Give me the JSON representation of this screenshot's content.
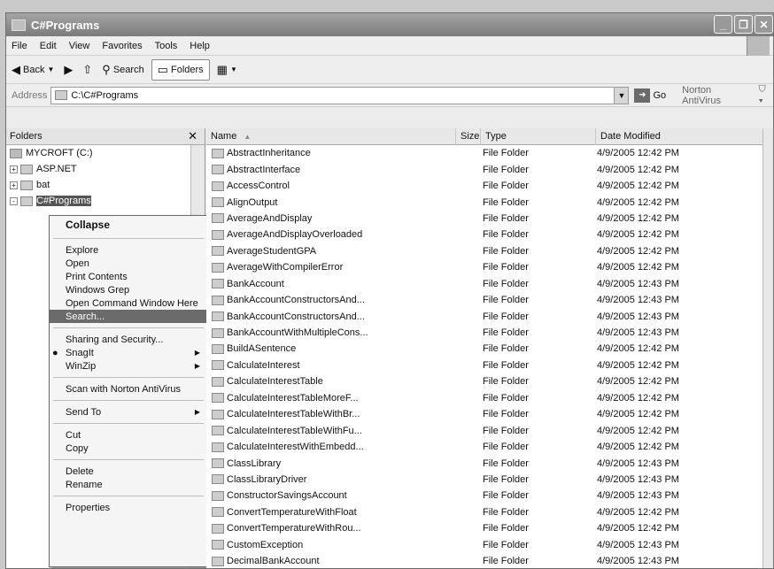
{
  "window": {
    "title": "C#Programs",
    "buttons": [
      "_",
      "❐",
      "✕"
    ]
  },
  "menu": [
    "File",
    "Edit",
    "View",
    "Favorites",
    "Tools",
    "Help"
  ],
  "toolbar": {
    "back": "Back",
    "search": "Search",
    "folders": "Folders"
  },
  "address": {
    "label": "Address",
    "value": "C:\\C#Programs",
    "go": "Go",
    "norton": "Norton AntiVirus"
  },
  "folders_pane": {
    "title": "Folders",
    "close": "✕",
    "items": [
      {
        "label": "MYCROFT (C:)",
        "exp": ""
      },
      {
        "label": "ASP.NET",
        "exp": "+"
      },
      {
        "label": "bat",
        "exp": "+"
      },
      {
        "label": "C#Programs",
        "exp": "-"
      }
    ]
  },
  "context_menu": {
    "items": [
      "Collapse",
      "Explore",
      "Open",
      "Print Contents",
      "Windows Grep",
      "Open Command Window Here",
      "Search...",
      "Sharing and Security...",
      "SnagIt",
      "WinZip",
      "Scan with Norton AntiVirus",
      "Send To",
      "Cut",
      "Copy",
      "Delete",
      "Rename",
      "Properties"
    ]
  },
  "columns": {
    "name": "Name",
    "sort": "▲",
    "size": "Size",
    "type": "Type",
    "date": "Date Modified"
  },
  "files": [
    {
      "name": "AbstractInheritance",
      "type": "File Folder",
      "date": "4/9/2005 12:42 PM"
    },
    {
      "name": "AbstractInterface",
      "type": "File Folder",
      "date": "4/9/2005 12:42 PM"
    },
    {
      "name": "AccessControl",
      "type": "File Folder",
      "date": "4/9/2005 12:42 PM"
    },
    {
      "name": "AlignOutput",
      "type": "File Folder",
      "date": "4/9/2005 12:42 PM"
    },
    {
      "name": "AverageAndDisplay",
      "type": "File Folder",
      "date": "4/9/2005 12:42 PM"
    },
    {
      "name": "AverageAndDisplayOverloaded",
      "type": "File Folder",
      "date": "4/9/2005 12:42 PM"
    },
    {
      "name": "AverageStudentGPA",
      "type": "File Folder",
      "date": "4/9/2005 12:42 PM"
    },
    {
      "name": "AverageWithCompilerError",
      "type": "File Folder",
      "date": "4/9/2005 12:42 PM"
    },
    {
      "name": "BankAccount",
      "type": "File Folder",
      "date": "4/9/2005 12:43 PM"
    },
    {
      "name": "BankAccountConstructorsAnd...",
      "type": "File Folder",
      "date": "4/9/2005 12:43 PM"
    },
    {
      "name": "BankAccountConstructorsAnd...",
      "type": "File Folder",
      "date": "4/9/2005 12:43 PM"
    },
    {
      "name": "BankAccountWithMultipleCons...",
      "type": "File Folder",
      "date": "4/9/2005 12:43 PM"
    },
    {
      "name": "BuildASentence",
      "type": "File Folder",
      "date": "4/9/2005 12:42 PM"
    },
    {
      "name": "CalculateInterest",
      "type": "File Folder",
      "date": "4/9/2005 12:42 PM"
    },
    {
      "name": "CalculateInterestTable",
      "type": "File Folder",
      "date": "4/9/2005 12:42 PM"
    },
    {
      "name": "CalculateInterestTableMoreF...",
      "type": "File Folder",
      "date": "4/9/2005 12:42 PM"
    },
    {
      "name": "CalculateInterestTableWithBr...",
      "type": "File Folder",
      "date": "4/9/2005 12:42 PM"
    },
    {
      "name": "CalculateInterestTableWithFu...",
      "type": "File Folder",
      "date": "4/9/2005 12:42 PM"
    },
    {
      "name": "CalculateInterestWithEmbedd...",
      "type": "File Folder",
      "date": "4/9/2005 12:42 PM"
    },
    {
      "name": "ClassLibrary",
      "type": "File Folder",
      "date": "4/9/2005 12:43 PM"
    },
    {
      "name": "ClassLibraryDriver",
      "type": "File Folder",
      "date": "4/9/2005 12:43 PM"
    },
    {
      "name": "ConstructorSavingsAccount",
      "type": "File Folder",
      "date": "4/9/2005 12:43 PM"
    },
    {
      "name": "ConvertTemperatureWithFloat",
      "type": "File Folder",
      "date": "4/9/2005 12:42 PM"
    },
    {
      "name": "ConvertTemperatureWithRou...",
      "type": "File Folder",
      "date": "4/9/2005 12:42 PM"
    },
    {
      "name": "CustomException",
      "type": "File Folder",
      "date": "4/9/2005 12:43 PM"
    },
    {
      "name": "DecimalBankAccount",
      "type": "File Folder",
      "date": "4/9/2005 12:43 PM"
    }
  ]
}
